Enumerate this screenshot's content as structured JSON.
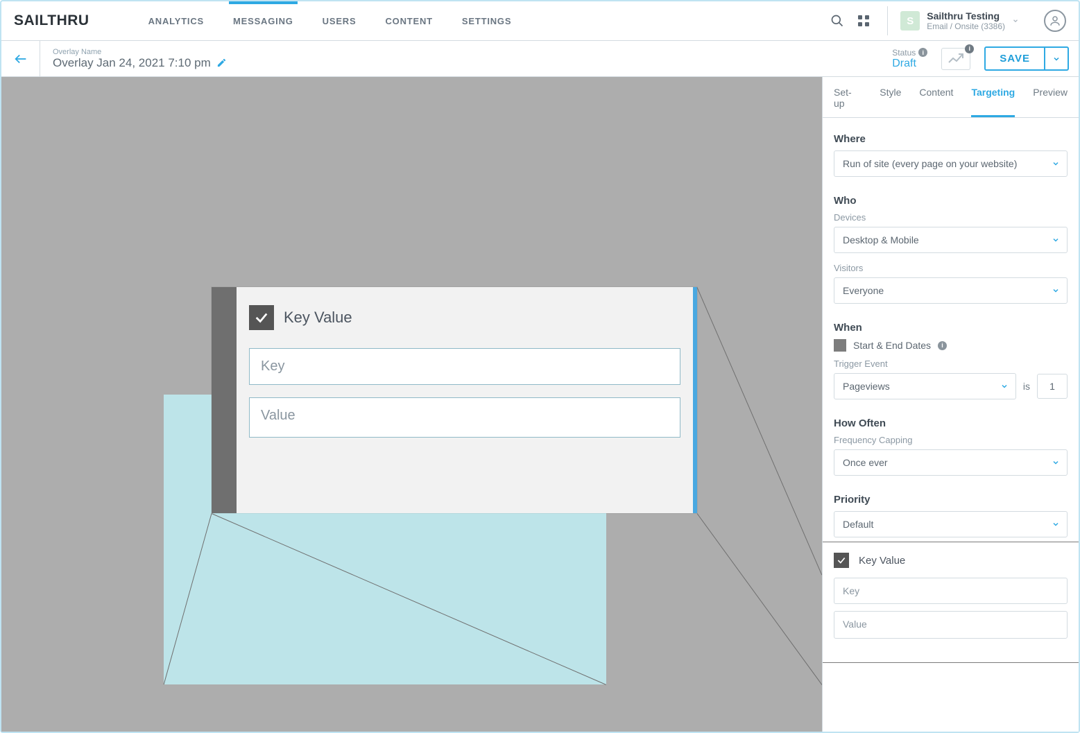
{
  "brand": "SAILTHRU",
  "nav": {
    "analytics": "ANALYTICS",
    "messaging": "MESSAGING",
    "users": "USERS",
    "content": "CONTENT",
    "settings": "SETTINGS"
  },
  "account": {
    "avatar_letter": "S",
    "name": "Sailthru Testing",
    "plan": "Email / Onsite (3386)"
  },
  "overlay": {
    "name_label": "Overlay Name",
    "name": "Overlay Jan 24, 2021 7:10 pm"
  },
  "status": {
    "label": "Status",
    "value": "Draft"
  },
  "save_label": "SAVE",
  "tabs": {
    "setup": "Set-up",
    "style": "Style",
    "content": "Content",
    "targeting": "Targeting",
    "preview": "Preview"
  },
  "panel": {
    "where": {
      "title": "Where",
      "value": "Run of site (every page on your website)"
    },
    "who": {
      "title": "Who",
      "devices_label": "Devices",
      "devices_value": "Desktop & Mobile",
      "visitors_label": "Visitors",
      "visitors_value": "Everyone"
    },
    "when": {
      "title": "When",
      "dates_label": "Start & End Dates",
      "trigger_label": "Trigger Event",
      "trigger_value": "Pageviews",
      "is_label": "is",
      "is_value": "1"
    },
    "how_often": {
      "title": "How Often",
      "freq_label": "Frequency Capping",
      "freq_value": "Once ever"
    },
    "priority": {
      "title": "Priority",
      "value": "Default"
    },
    "kv": {
      "title": "Key Value",
      "key_placeholder": "Key",
      "value_placeholder": "Value"
    }
  },
  "zoom_kv": {
    "title": "Key Value",
    "key_placeholder": "Key",
    "value_placeholder": "Value"
  }
}
